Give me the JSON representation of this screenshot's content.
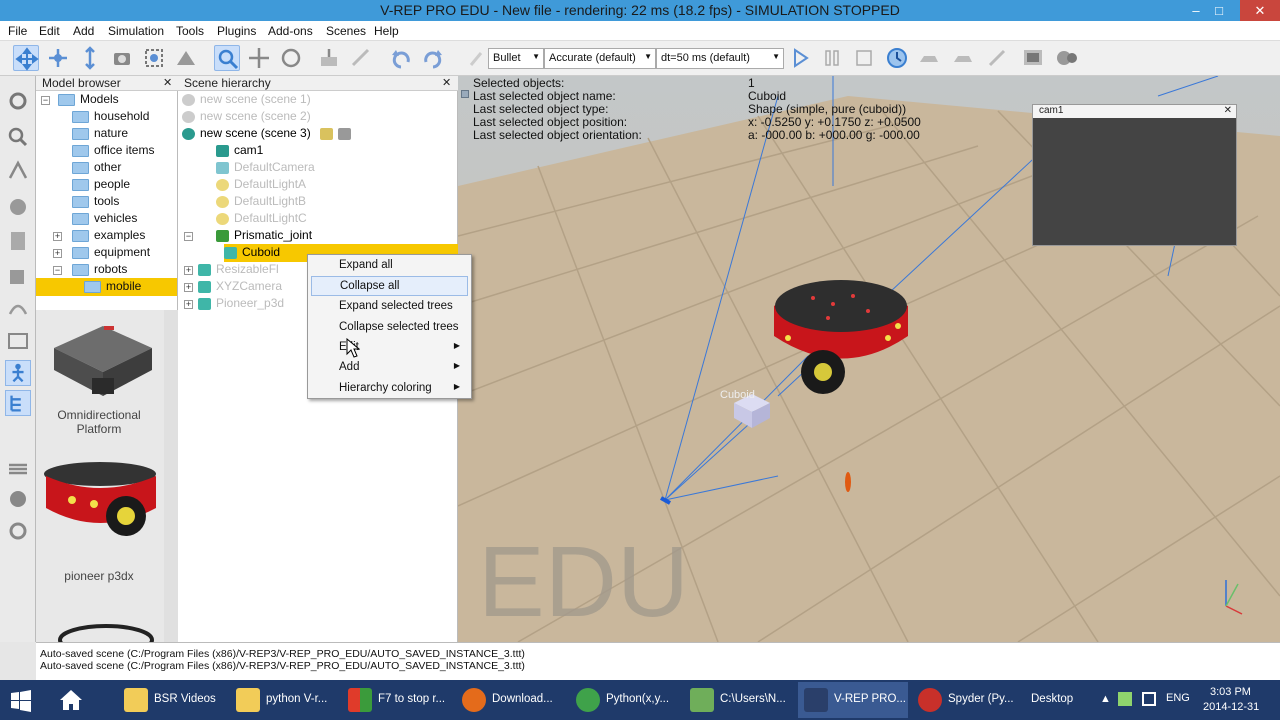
{
  "window": {
    "title": "V-REP PRO EDU - New file - rendering: 22 ms (18.2 fps) - SIMULATION STOPPED",
    "min": "–",
    "max": "□",
    "close": "✕"
  },
  "menu": [
    "File",
    "Edit",
    "Add",
    "Simulation",
    "Tools",
    "Plugins",
    "Add-ons",
    "Scenes",
    "Help"
  ],
  "toolbar": {
    "engine": "Bullet",
    "accuracy": "Accurate (default)",
    "dt": "dt=50 ms (default)"
  },
  "model_browser": {
    "title": "Model browser",
    "close": "✕",
    "items": [
      {
        "label": "Models",
        "expander": "−"
      },
      {
        "label": "household"
      },
      {
        "label": "nature"
      },
      {
        "label": "office items"
      },
      {
        "label": "other"
      },
      {
        "label": "people"
      },
      {
        "label": "tools"
      },
      {
        "label": "vehicles"
      },
      {
        "label": "examples",
        "expander": "+"
      },
      {
        "label": "equipment",
        "expander": "+"
      },
      {
        "label": "robots",
        "expander": "−"
      },
      {
        "label": "mobile"
      }
    ],
    "thumbs": [
      {
        "label": "Omnidirectional Platform"
      },
      {
        "label": "pioneer p3dx"
      }
    ]
  },
  "scene_hierarchy": {
    "title": "Scene hierarchy",
    "close": "✕",
    "items": [
      {
        "label": "new scene (scene 1)",
        "dim": true
      },
      {
        "label": "new scene (scene 2)",
        "dim": true
      },
      {
        "label": "new scene (scene 3)",
        "dim": false
      },
      {
        "label": "cam1",
        "dim": false
      },
      {
        "label": "DefaultCamera",
        "dim": true
      },
      {
        "label": "DefaultLightA",
        "dim": true
      },
      {
        "label": "DefaultLightB",
        "dim": true
      },
      {
        "label": "DefaultLightC",
        "dim": true
      },
      {
        "label": "Prismatic_joint",
        "dim": false
      },
      {
        "label": "Cuboid",
        "dim": false
      },
      {
        "label": "ResizableFl",
        "dim": true
      },
      {
        "label": "XYZCamera",
        "dim": true
      },
      {
        "label": "Pioneer_p3d",
        "dim": true
      }
    ]
  },
  "context_menu": {
    "items": [
      {
        "label": "Expand all",
        "submenu": false
      },
      {
        "label": "Collapse all",
        "submenu": false
      },
      {
        "label": "Expand selected trees",
        "submenu": false
      },
      {
        "label": "Collapse selected trees",
        "submenu": false
      },
      {
        "label": "Edit",
        "submenu": true
      },
      {
        "label": "Add",
        "submenu": true
      },
      {
        "label": "Hierarchy coloring",
        "submenu": true
      }
    ],
    "highlighted": "Collapse all",
    "submenu_arrow": "▶"
  },
  "selection_info": {
    "labels": [
      "Selected objects:",
      "Last selected object name:",
      "Last selected object type:",
      "Last selected object position:",
      "Last selected object orientation:"
    ],
    "values": [
      "1",
      "Cuboid",
      "Shape (simple, pure (cuboid))",
      "x: -0.5250   y: +0.1750   z: +0.0500",
      "a: -000.00   b: +000.00   g: -000.00"
    ]
  },
  "viewport": {
    "watermark": "EDU",
    "object_label": "Cuboid"
  },
  "cam_window": {
    "title": "cam1",
    "close": "✕"
  },
  "status": {
    "lines": [
      "Auto-saved scene (C:/Program Files (x86)/V-REP3/V-REP_PRO_EDU/AUTO_SAVED_INSTANCE_3.ttt)",
      "Auto-saved scene (C:/Program Files (x86)/V-REP3/V-REP_PRO_EDU/AUTO_SAVED_INSTANCE_3.ttt)"
    ]
  },
  "taskbar": {
    "tasks": [
      "BSR Videos",
      "python V-r...",
      "F7 to stop r...",
      "Download...",
      "Python(x,y...",
      "C:\\Users\\N...",
      "V-REP PRO...",
      "Spyder (Py..."
    ],
    "desktop": "Desktop",
    "lang": "ENG",
    "time": "3:03 PM",
    "date": "2014-12-31"
  },
  "colors": {
    "titlebar": "#3f9ad9",
    "selection": "#f7c800",
    "taskbar": "#1f3a6a",
    "floor": "#c9b79c"
  }
}
